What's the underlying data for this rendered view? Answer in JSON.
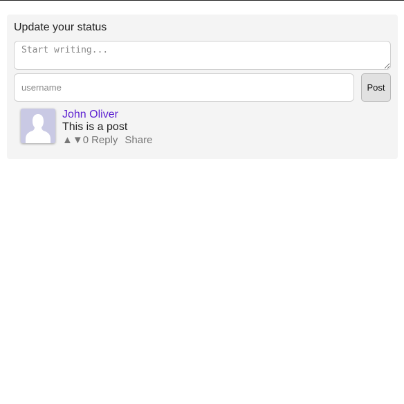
{
  "composer": {
    "title": "Update your status",
    "textarea_placeholder": "Start writing...",
    "textarea_value": "",
    "username_placeholder": "username",
    "username_value": "",
    "post_button_label": "Post"
  },
  "posts": [
    {
      "author": "John Oliver",
      "text": "This is a post",
      "upvote_icon": "▲",
      "downvote_icon": "▼",
      "score": "0",
      "reply_label": "Reply",
      "share_label": "Share"
    }
  ],
  "colors": {
    "panel_background": "#f4f4f4",
    "author_link": "#5b1fd1",
    "action_text": "#777777",
    "avatar_background": "#c9c9e4"
  },
  "icons": {
    "avatar": "default-user-silhouette-icon",
    "upvote": "triangle-up-icon",
    "downvote": "triangle-down-icon"
  }
}
